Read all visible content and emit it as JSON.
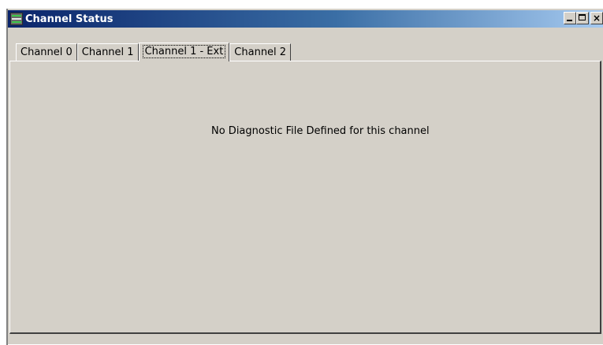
{
  "window": {
    "title": "Channel Status",
    "icon": "channel-status-app-icon",
    "controls": {
      "minimize": "minimize-icon",
      "maximize": "maximize-icon",
      "close": "×"
    }
  },
  "tabs": [
    {
      "label": "Channel 0",
      "active": false
    },
    {
      "label": "Channel 1",
      "active": false
    },
    {
      "label": "Channel 1 - Ext",
      "active": true
    },
    {
      "label": "Channel 2",
      "active": false
    }
  ],
  "panel": {
    "message": "No Diagnostic File Defined for this channel"
  },
  "colors": {
    "titlebar_start": "#0a246a",
    "titlebar_end": "#a6caf0",
    "face": "#d4d0c8",
    "shadow": "#404040",
    "highlight": "#ffffff"
  }
}
